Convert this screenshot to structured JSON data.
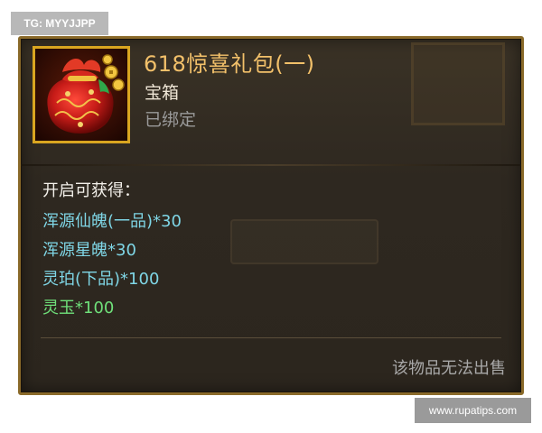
{
  "watermarks": {
    "top": "TG: MYYJJPP",
    "bottom": "www.rupatips.com"
  },
  "item": {
    "name": "618惊喜礼包(一)",
    "type": "宝箱",
    "bind_status": "已绑定",
    "icon": "red-gift-bag-icon",
    "name_color": "#f2c06a"
  },
  "contents": {
    "title": "开启可获得：",
    "rewards": [
      {
        "text": "浑源仙魄(一品)*30",
        "color": "#7fd6e6"
      },
      {
        "text": "浑源星魄*30",
        "color": "#7fd6e6"
      },
      {
        "text": "灵珀(下品)*100",
        "color": "#7fd6e6"
      },
      {
        "text": "灵玉*100",
        "color": "#6fe07a"
      }
    ]
  },
  "footer_note": "该物品无法出售",
  "colors": {
    "frame_gold": "#d9a520",
    "panel_bg": "#2e2820",
    "border": "#8a6a2a"
  }
}
